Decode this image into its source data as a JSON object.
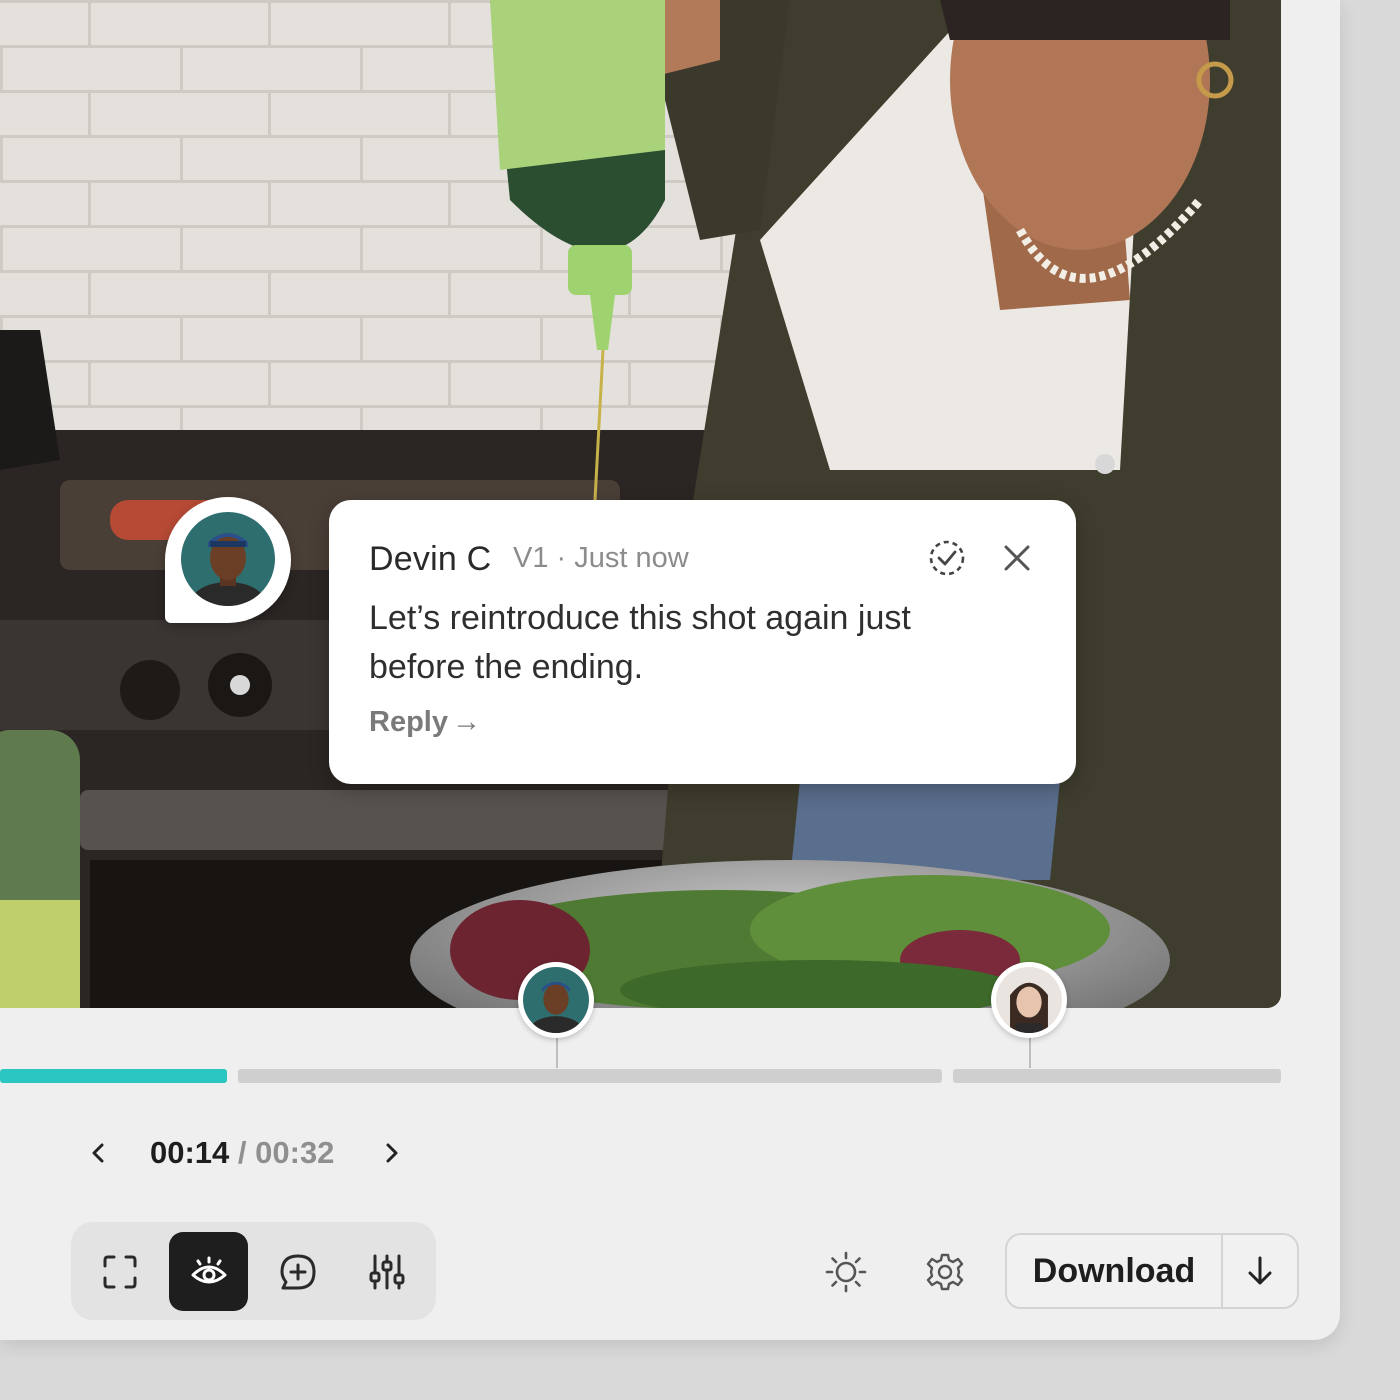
{
  "comment": {
    "author": "Devin C",
    "meta": "V1 · Just now",
    "body": "Let’s reintroduce this shot again just before the ending.",
    "reply_label": "Reply",
    "reply_arrow": "→"
  },
  "playback": {
    "current_time": "00:14",
    "separator": " / ",
    "total_time": "00:32",
    "progress_fraction": 0.16
  },
  "toolbar": {
    "tools": [
      {
        "name": "fullscreen-icon",
        "active": false
      },
      {
        "name": "eye-icon",
        "active": true
      },
      {
        "name": "add-comment-icon",
        "active": false
      },
      {
        "name": "adjust-sliders-icon",
        "active": false
      }
    ],
    "right_icons": [
      "brightness-icon",
      "settings-gear-icon"
    ],
    "download_label": "Download"
  },
  "colors": {
    "progress_fill": "#2bc6c1",
    "track": "#cfcfcf",
    "active_tool": "#1e1e1e"
  }
}
